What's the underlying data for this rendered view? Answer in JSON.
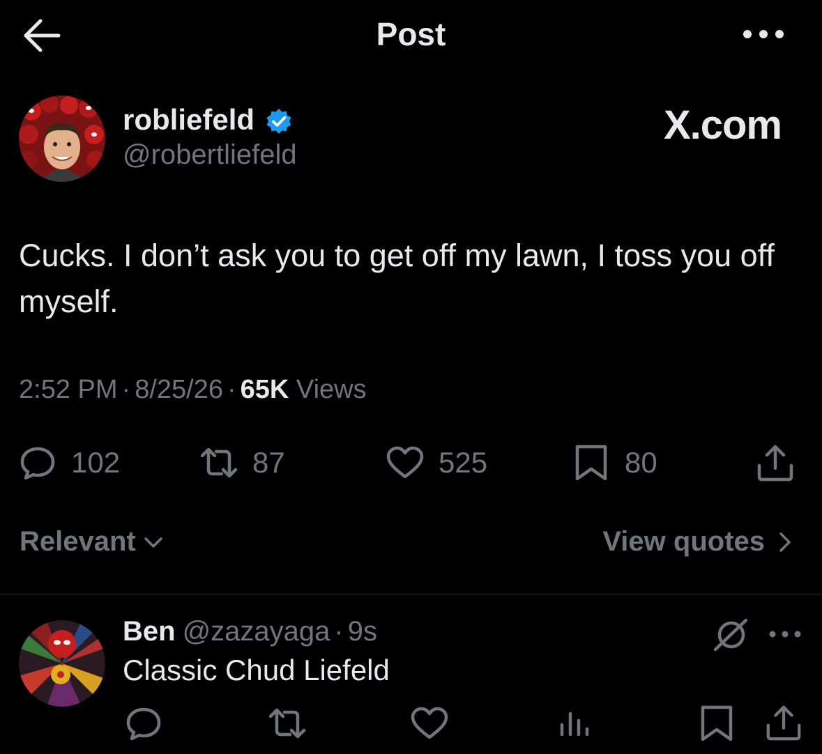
{
  "header": {
    "title": "Post",
    "back_icon": "arrow-left-icon",
    "more_icon": "ellipsis-icon"
  },
  "author": {
    "name": "robliefeld",
    "handle": "@robertliefeld",
    "verified": true,
    "verified_color": "#1d9bf0"
  },
  "watermark": "X.com",
  "post": {
    "text": "Cucks. I don’t ask you to get off my lawn, I toss you off myself.",
    "time": "2:52 PM",
    "separator": "·",
    "date": "8/25/26",
    "views_count": "65K",
    "views_label": "Views"
  },
  "actions": {
    "replies": "102",
    "reposts": "87",
    "likes": "525",
    "bookmarks": "80"
  },
  "sort": {
    "label": "Relevant",
    "quotes_label": "View quotes"
  },
  "reply": {
    "name": "Ben",
    "handle": "@zazayaga",
    "separator": "·",
    "time": "9s",
    "text": "Classic Chud Liefeld"
  },
  "colors": {
    "background": "#000000",
    "primary_text": "#e7e9ea",
    "secondary_text": "#71767b",
    "divider": "#2f3336",
    "accent": "#1d9bf0"
  }
}
